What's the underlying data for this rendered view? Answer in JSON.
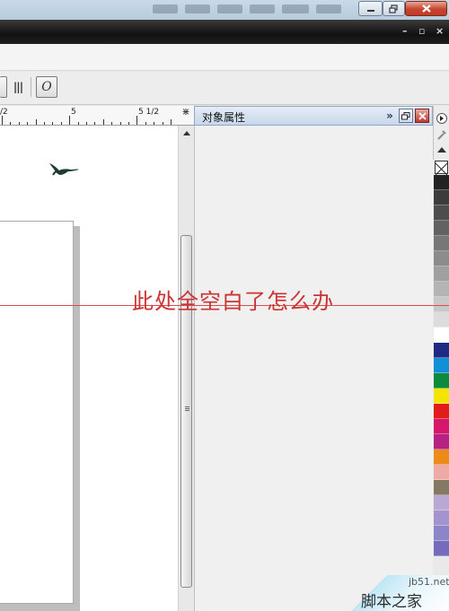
{
  "window": {
    "minimize_icon": "minimize-icon",
    "maximize_icon": "restore-icon",
    "close_icon": "close-icon"
  },
  "app_bar": {
    "mdi_restore": "▫",
    "mdi_close": "×"
  },
  "toolbar": {
    "text_tool_label": "O",
    "columns_label": "|||"
  },
  "ruler": {
    "labels": [
      "/2",
      "5",
      "5 1/2"
    ],
    "corner_glyph": "⋇"
  },
  "docker": {
    "title": "对象属性",
    "expand_label": "»"
  },
  "palette": {
    "colors": [
      "#222222",
      "#3c3c3c",
      "#4d4d4d",
      "#626262",
      "#777777",
      "#8c8c8c",
      "#a0a0a0",
      "#b4b4b4",
      "#c8c8c8",
      "#dcdcdc",
      "#ffffff",
      "#1f2a83",
      "#1190d8",
      "#0d8a3a",
      "#f3e500",
      "#e21b1b",
      "#d6176e",
      "#b52281",
      "#ec8a1a",
      "#f0aaa6",
      "#867963",
      "#b9a8d3",
      "#a394cf",
      "#8c86c9",
      "#746cba"
    ]
  },
  "annotation": {
    "text": "此处全空白了怎么办",
    "color": "#cc3333"
  },
  "watermark": {
    "url": "jb51.net",
    "name": "脚本之家"
  }
}
